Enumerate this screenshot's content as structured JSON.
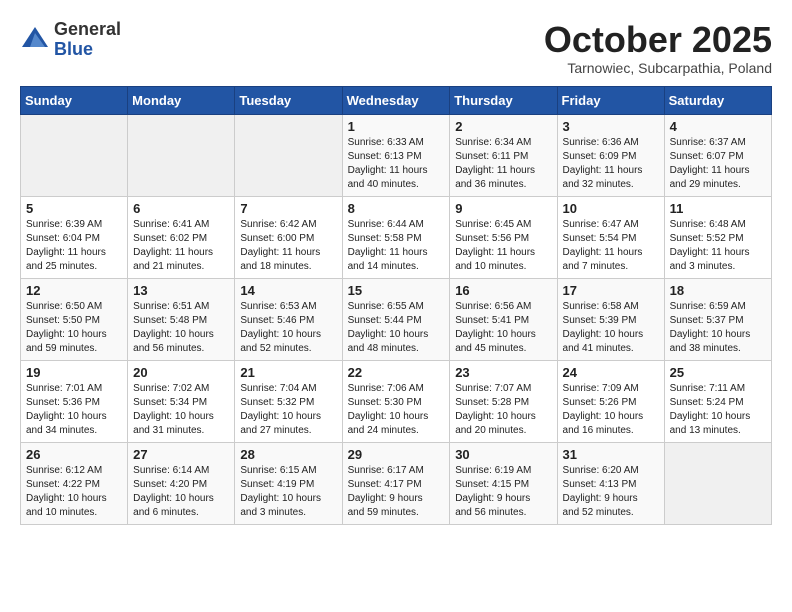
{
  "header": {
    "logo_general": "General",
    "logo_blue": "Blue",
    "month_title": "October 2025",
    "subtitle": "Tarnowiec, Subcarpathia, Poland"
  },
  "weekdays": [
    "Sunday",
    "Monday",
    "Tuesday",
    "Wednesday",
    "Thursday",
    "Friday",
    "Saturday"
  ],
  "weeks": [
    [
      {
        "day": "",
        "info": ""
      },
      {
        "day": "",
        "info": ""
      },
      {
        "day": "",
        "info": ""
      },
      {
        "day": "1",
        "info": "Sunrise: 6:33 AM\nSunset: 6:13 PM\nDaylight: 11 hours\nand 40 minutes."
      },
      {
        "day": "2",
        "info": "Sunrise: 6:34 AM\nSunset: 6:11 PM\nDaylight: 11 hours\nand 36 minutes."
      },
      {
        "day": "3",
        "info": "Sunrise: 6:36 AM\nSunset: 6:09 PM\nDaylight: 11 hours\nand 32 minutes."
      },
      {
        "day": "4",
        "info": "Sunrise: 6:37 AM\nSunset: 6:07 PM\nDaylight: 11 hours\nand 29 minutes."
      }
    ],
    [
      {
        "day": "5",
        "info": "Sunrise: 6:39 AM\nSunset: 6:04 PM\nDaylight: 11 hours\nand 25 minutes."
      },
      {
        "day": "6",
        "info": "Sunrise: 6:41 AM\nSunset: 6:02 PM\nDaylight: 11 hours\nand 21 minutes."
      },
      {
        "day": "7",
        "info": "Sunrise: 6:42 AM\nSunset: 6:00 PM\nDaylight: 11 hours\nand 18 minutes."
      },
      {
        "day": "8",
        "info": "Sunrise: 6:44 AM\nSunset: 5:58 PM\nDaylight: 11 hours\nand 14 minutes."
      },
      {
        "day": "9",
        "info": "Sunrise: 6:45 AM\nSunset: 5:56 PM\nDaylight: 11 hours\nand 10 minutes."
      },
      {
        "day": "10",
        "info": "Sunrise: 6:47 AM\nSunset: 5:54 PM\nDaylight: 11 hours\nand 7 minutes."
      },
      {
        "day": "11",
        "info": "Sunrise: 6:48 AM\nSunset: 5:52 PM\nDaylight: 11 hours\nand 3 minutes."
      }
    ],
    [
      {
        "day": "12",
        "info": "Sunrise: 6:50 AM\nSunset: 5:50 PM\nDaylight: 10 hours\nand 59 minutes."
      },
      {
        "day": "13",
        "info": "Sunrise: 6:51 AM\nSunset: 5:48 PM\nDaylight: 10 hours\nand 56 minutes."
      },
      {
        "day": "14",
        "info": "Sunrise: 6:53 AM\nSunset: 5:46 PM\nDaylight: 10 hours\nand 52 minutes."
      },
      {
        "day": "15",
        "info": "Sunrise: 6:55 AM\nSunset: 5:44 PM\nDaylight: 10 hours\nand 48 minutes."
      },
      {
        "day": "16",
        "info": "Sunrise: 6:56 AM\nSunset: 5:41 PM\nDaylight: 10 hours\nand 45 minutes."
      },
      {
        "day": "17",
        "info": "Sunrise: 6:58 AM\nSunset: 5:39 PM\nDaylight: 10 hours\nand 41 minutes."
      },
      {
        "day": "18",
        "info": "Sunrise: 6:59 AM\nSunset: 5:37 PM\nDaylight: 10 hours\nand 38 minutes."
      }
    ],
    [
      {
        "day": "19",
        "info": "Sunrise: 7:01 AM\nSunset: 5:36 PM\nDaylight: 10 hours\nand 34 minutes."
      },
      {
        "day": "20",
        "info": "Sunrise: 7:02 AM\nSunset: 5:34 PM\nDaylight: 10 hours\nand 31 minutes."
      },
      {
        "day": "21",
        "info": "Sunrise: 7:04 AM\nSunset: 5:32 PM\nDaylight: 10 hours\nand 27 minutes."
      },
      {
        "day": "22",
        "info": "Sunrise: 7:06 AM\nSunset: 5:30 PM\nDaylight: 10 hours\nand 24 minutes."
      },
      {
        "day": "23",
        "info": "Sunrise: 7:07 AM\nSunset: 5:28 PM\nDaylight: 10 hours\nand 20 minutes."
      },
      {
        "day": "24",
        "info": "Sunrise: 7:09 AM\nSunset: 5:26 PM\nDaylight: 10 hours\nand 16 minutes."
      },
      {
        "day": "25",
        "info": "Sunrise: 7:11 AM\nSunset: 5:24 PM\nDaylight: 10 hours\nand 13 minutes."
      }
    ],
    [
      {
        "day": "26",
        "info": "Sunrise: 6:12 AM\nSunset: 4:22 PM\nDaylight: 10 hours\nand 10 minutes."
      },
      {
        "day": "27",
        "info": "Sunrise: 6:14 AM\nSunset: 4:20 PM\nDaylight: 10 hours\nand 6 minutes."
      },
      {
        "day": "28",
        "info": "Sunrise: 6:15 AM\nSunset: 4:19 PM\nDaylight: 10 hours\nand 3 minutes."
      },
      {
        "day": "29",
        "info": "Sunrise: 6:17 AM\nSunset: 4:17 PM\nDaylight: 9 hours\nand 59 minutes."
      },
      {
        "day": "30",
        "info": "Sunrise: 6:19 AM\nSunset: 4:15 PM\nDaylight: 9 hours\nand 56 minutes."
      },
      {
        "day": "31",
        "info": "Sunrise: 6:20 AM\nSunset: 4:13 PM\nDaylight: 9 hours\nand 52 minutes."
      },
      {
        "day": "",
        "info": ""
      }
    ]
  ]
}
